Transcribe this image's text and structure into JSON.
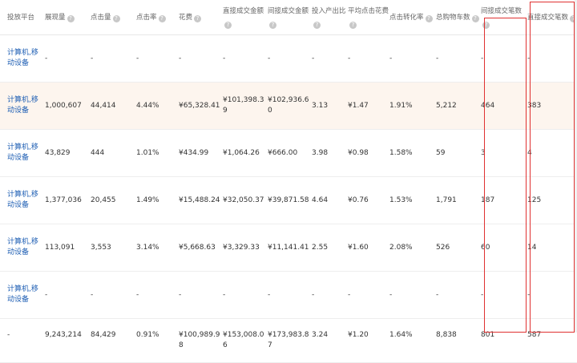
{
  "headers": [
    "投放平台",
    "展现量",
    "点击量",
    "点击率",
    "花费",
    "直接成交金额",
    "间接成交金额",
    "投入产出比",
    "平均点击花费",
    "点击转化率",
    "总购物车数",
    "间接成交笔数",
    "直接成交笔数"
  ],
  "header_help_icon": "question-circle-icon",
  "rows": [
    {
      "platform": "计算机,移动设备",
      "impressions": "-",
      "clicks": "-",
      "ctr": "-",
      "cost": "-",
      "direct_amount": "-",
      "indirect_amount": "-",
      "roi": "-",
      "avg_cpc": "-",
      "cvr": "-",
      "cart": "-",
      "indirect_orders": "-",
      "direct_orders": "-"
    },
    {
      "platform": "计算机,移动设备",
      "impressions": "1,000,607",
      "clicks": "44,414",
      "ctr": "4.44%",
      "cost": "¥65,328.41",
      "direct_amount": "¥101,398.39",
      "indirect_amount": "¥102,936.60",
      "roi": "3.13",
      "avg_cpc": "¥1.47",
      "cvr": "1.91%",
      "cart": "5,212",
      "indirect_orders": "464",
      "direct_orders": "383"
    },
    {
      "platform": "计算机,移动设备",
      "impressions": "43,829",
      "clicks": "444",
      "ctr": "1.01%",
      "cost": "¥434.99",
      "direct_amount": "¥1,064.26",
      "indirect_amount": "¥666.00",
      "roi": "3.98",
      "avg_cpc": "¥0.98",
      "cvr": "1.58%",
      "cart": "59",
      "indirect_orders": "3",
      "direct_orders": "4"
    },
    {
      "platform": "计算机,移动设备",
      "impressions": "1,377,036",
      "clicks": "20,455",
      "ctr": "1.49%",
      "cost": "¥15,488.24",
      "direct_amount": "¥32,050.37",
      "indirect_amount": "¥39,871.58",
      "roi": "4.64",
      "avg_cpc": "¥0.76",
      "cvr": "1.53%",
      "cart": "1,791",
      "indirect_orders": "187",
      "direct_orders": "125"
    },
    {
      "platform": "计算机,移动设备",
      "impressions": "113,091",
      "clicks": "3,553",
      "ctr": "3.14%",
      "cost": "¥5,668.63",
      "direct_amount": "¥3,329.33",
      "indirect_amount": "¥11,141.41",
      "roi": "2.55",
      "avg_cpc": "¥1.60",
      "cvr": "2.08%",
      "cart": "526",
      "indirect_orders": "60",
      "direct_orders": "14"
    },
    {
      "platform": "计算机,移动设备",
      "impressions": "-",
      "clicks": "-",
      "ctr": "-",
      "cost": "-",
      "direct_amount": "-",
      "indirect_amount": "-",
      "roi": "-",
      "avg_cpc": "-",
      "cvr": "-",
      "cart": "-",
      "indirect_orders": "-",
      "direct_orders": "-"
    },
    {
      "platform": "-",
      "impressions": "9,243,214",
      "clicks": "84,429",
      "ctr": "0.91%",
      "cost": "¥100,989.98",
      "direct_amount": "¥153,008.06",
      "indirect_amount": "¥173,983.87",
      "roi": "3.24",
      "avg_cpc": "¥1.20",
      "cvr": "1.64%",
      "cart": "8,838",
      "indirect_orders": "801",
      "direct_orders": "587"
    }
  ],
  "help_columns": [
    1,
    2,
    3,
    4,
    5,
    6,
    7,
    8,
    9,
    10,
    11,
    12
  ],
  "highlight_row": 1,
  "highlight_color": "#fdf5ee",
  "annotation_color": "#e03131",
  "link_color": "#1f5fb4"
}
